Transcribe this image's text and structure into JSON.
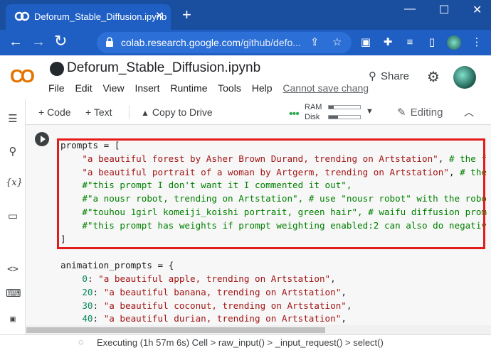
{
  "browser": {
    "tab_title": "Deforum_Stable_Diffusion.ipynb",
    "tab_close": "✕",
    "new_tab": "+",
    "url_host": "colab.research.google.com",
    "url_path": "/github/defo...",
    "window_controls": [
      "—",
      "☐",
      "✕"
    ]
  },
  "colab": {
    "logo": "CO",
    "notebook_title": "Deforum_Stable_Diffusion.ipynb",
    "menu": [
      "File",
      "Edit",
      "View",
      "Insert",
      "Runtime",
      "Tools",
      "Help"
    ],
    "unsaved_notice": "Cannot save chang",
    "share_label": "Share"
  },
  "toolbar": {
    "add_code": "+ Code",
    "add_text": "+ Text",
    "copy_to_drive": "Copy to Drive",
    "ram_label": "RAM",
    "disk_label": "Disk",
    "ram_usage": 0.15,
    "disk_usage": 0.3,
    "editing_label": "Editing"
  },
  "code_lines": [
    [
      {
        "t": "prompts = [",
        "c": ""
      }
    ],
    [
      {
        "t": "    ",
        "c": ""
      },
      {
        "t": "\"a beautiful forest by Asher Brown Durand, trending on Artstation\"",
        "c": "str"
      },
      {
        "t": ", ",
        "c": ""
      },
      {
        "t": "# the f",
        "c": "cmt"
      }
    ],
    [
      {
        "t": "    ",
        "c": ""
      },
      {
        "t": "\"a beautiful portrait of a woman by Artgerm, trending on Artstation\"",
        "c": "str"
      },
      {
        "t": ", ",
        "c": ""
      },
      {
        "t": "# the",
        "c": "cmt"
      }
    ],
    [
      {
        "t": "    ",
        "c": ""
      },
      {
        "t": "#\"this prompt I don't want it I commented it out\",",
        "c": "cmt"
      }
    ],
    [
      {
        "t": "    ",
        "c": ""
      },
      {
        "t": "#\"a nousr robot, trending on Artstation\", # use \"nousr robot\" with the robo",
        "c": "cmt"
      }
    ],
    [
      {
        "t": "    ",
        "c": ""
      },
      {
        "t": "#\"touhou 1girl komeiji_koishi portrait, green hair\", # waifu diffusion prom",
        "c": "cmt"
      }
    ],
    [
      {
        "t": "    ",
        "c": ""
      },
      {
        "t": "#\"this prompt has weights if prompt weighting enabled:2 can also do negativ",
        "c": "cmt"
      }
    ],
    [
      {
        "t": "]",
        "c": ""
      }
    ],
    [
      {
        "t": "",
        "c": ""
      }
    ],
    [
      {
        "t": "animation_prompts = {",
        "c": ""
      }
    ],
    [
      {
        "t": "    ",
        "c": ""
      },
      {
        "t": "0",
        "c": "num"
      },
      {
        "t": ": ",
        "c": ""
      },
      {
        "t": "\"a beautiful apple, trending on Artstation\"",
        "c": "str"
      },
      {
        "t": ",",
        "c": ""
      }
    ],
    [
      {
        "t": "    ",
        "c": ""
      },
      {
        "t": "20",
        "c": "num"
      },
      {
        "t": ": ",
        "c": ""
      },
      {
        "t": "\"a beautiful banana, trending on Artstation\"",
        "c": "str"
      },
      {
        "t": ",",
        "c": ""
      }
    ],
    [
      {
        "t": "    ",
        "c": ""
      },
      {
        "t": "30",
        "c": "num"
      },
      {
        "t": ": ",
        "c": ""
      },
      {
        "t": "\"a beautiful coconut, trending on Artstation\"",
        "c": "str"
      },
      {
        "t": ",",
        "c": ""
      }
    ],
    [
      {
        "t": "    ",
        "c": ""
      },
      {
        "t": "40",
        "c": "num"
      },
      {
        "t": ": ",
        "c": ""
      },
      {
        "t": "\"a beautiful durian, trending on Artstation\"",
        "c": "str"
      },
      {
        "t": ",",
        "c": ""
      }
    ]
  ],
  "status": {
    "text": "Executing (1h 57m 6s)  Cell > raw_input() > _input_request() > select()"
  },
  "colors": {
    "chrome_dark": "#1a4fa0",
    "chrome": "#1f5fc4",
    "highlight": "#e41b1b",
    "string": "#a31515",
    "comment": "#008000"
  }
}
